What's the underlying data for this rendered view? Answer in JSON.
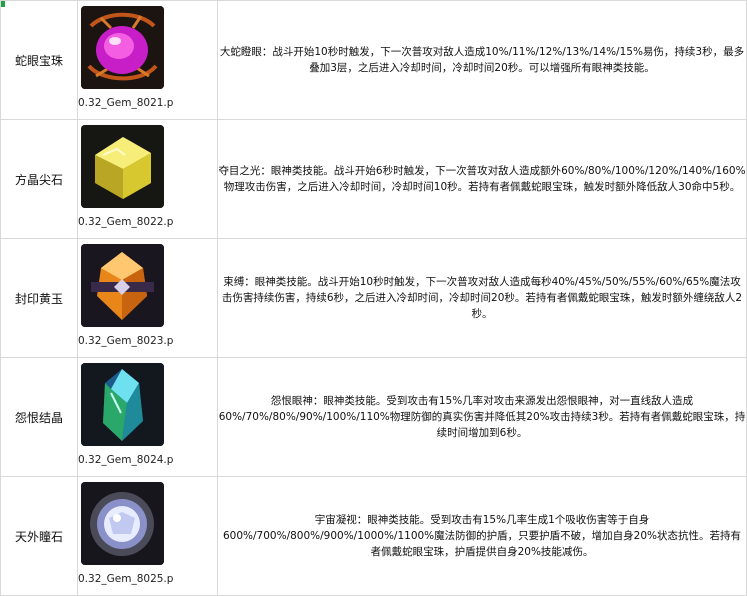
{
  "gems": [
    {
      "name": "蛇眼宝珠",
      "file": "0.32_Gem_8021.p",
      "icon": "snake-eye-gem-icon",
      "colors": {
        "main": "#c81ec8",
        "accent": "#ff6ee8",
        "frame": "#c2561a"
      },
      "desc": "大蛇瞪眼：战斗开始10秒时触发，下一次普攻对敌人造成10%/11%/12%/13%/14%/15%易伤，持续3秒，最多叠加3层，之后进入冷却时间，冷却时间20秒。可以增强所有眼神类技能。"
    },
    {
      "name": "方晶尖石",
      "file": "0.32_Gem_8022.p",
      "icon": "square-crystal-gem-icon",
      "colors": {
        "main": "#d8c830",
        "accent": "#f7ee7a",
        "frame": "#8a7c18"
      },
      "desc": "夺目之光：眼神类技能。战斗开始6秒时触发，下一次普攻对敌人造成额外60%/80%/100%/120%/140%/160%物理攻击伤害，之后进入冷却时间，冷却时间10秒。若持有者佩戴蛇眼宝珠，触发时额外降低敌人30命中5秒。"
    },
    {
      "name": "封印黄玉",
      "file": "0.32_Gem_8023.p",
      "icon": "sealed-topaz-gem-icon",
      "colors": {
        "main": "#e8861a",
        "accent": "#ffc870",
        "frame": "#3a2a4a"
      },
      "desc": "束缚：眼神类技能。战斗开始10秒时触发，下一次普攻对敌人造成每秒40%/45%/50%/55%/60%/65%魔法攻击伤害持续伤害，持续6秒，之后进入冷却时间，冷却时间20秒。若持有者佩戴蛇眼宝珠，触发时额外缠绕敌人2秒。"
    },
    {
      "name": "怨恨结晶",
      "file": "0.32_Gem_8024.p",
      "icon": "resentment-crystal-gem-icon",
      "colors": {
        "main": "#2aa86a",
        "accent": "#6ee0f0",
        "frame": "#1b5a8a"
      },
      "desc": "怨恨眼神：眼神类技能。受到攻击有15%几率对攻击来源发出怨恨眼神，对一直线敌人造成60%/70%/80%/90%/100%/110%物理防御的真实伤害并降低其20%攻击持续3秒。若持有者佩戴蛇眼宝珠，持续时间增加到6秒。"
    },
    {
      "name": "天外瞳石",
      "file": "0.32_Gem_8025.p",
      "icon": "outer-sky-pupil-gem-icon",
      "colors": {
        "main": "#8a90c8",
        "accent": "#e8ecff",
        "frame": "#4a4a58"
      },
      "desc": "宇宙凝视：眼神类技能。受到攻击有15%几率生成1个吸收伤害等于自身600%/700%/800%/900%/1000%/1100%魔法防御的护盾，只要护盾不破，增加自身20%状态抗性。若持有者佩戴蛇眼宝珠，护盾提供自身20%技能减伤。"
    }
  ]
}
